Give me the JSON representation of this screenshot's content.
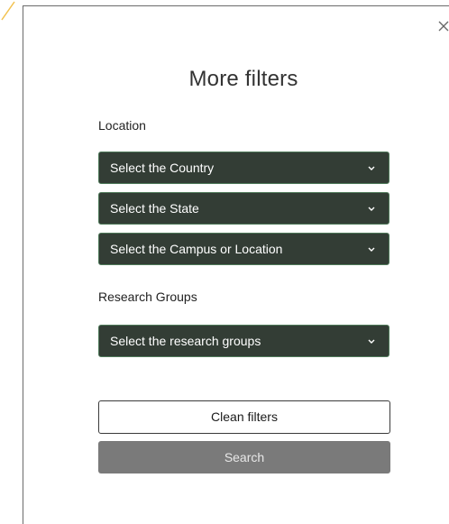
{
  "modal": {
    "title": "More filters",
    "close_icon": "close-icon"
  },
  "location": {
    "label": "Location",
    "selects": [
      {
        "placeholder": "Select the Country"
      },
      {
        "placeholder": "Select the State"
      },
      {
        "placeholder": "Select the Campus or Location"
      }
    ]
  },
  "research": {
    "label": "Research Groups",
    "select": {
      "placeholder": "Select the research groups"
    }
  },
  "actions": {
    "clean_label": "Clean filters",
    "search_label": "Search"
  },
  "colors": {
    "select_bg": "#333d35",
    "select_border": "#4f7a5a",
    "search_bg": "#7a7a7a",
    "accent": "#f2c14e"
  }
}
